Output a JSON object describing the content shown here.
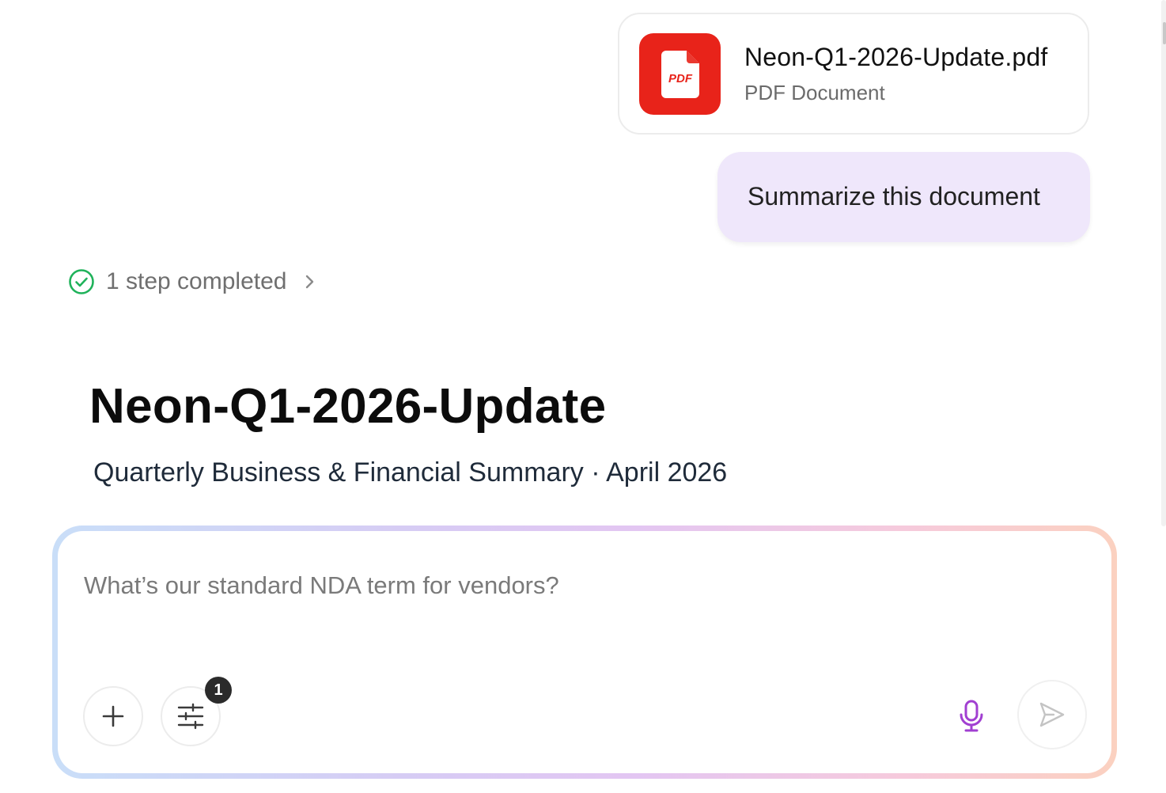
{
  "attachment": {
    "file_name": "Neon-Q1-2026-Update.pdf",
    "file_type": "PDF Document",
    "icon_label": "PDF",
    "icon_color": "#e8231a"
  },
  "user_message": {
    "text": "Summarize this document"
  },
  "step_status": {
    "label": "1 step completed",
    "status_color": "#1fb25a"
  },
  "document": {
    "title": "Neon-Q1-2026-Update",
    "subtitle": "Quarterly Business & Financial Summary · April 2026"
  },
  "composer": {
    "placeholder": "What’s our standard NDA term for vendors?",
    "tools_badge_count": "1",
    "mic_color": "#a13fd1"
  }
}
